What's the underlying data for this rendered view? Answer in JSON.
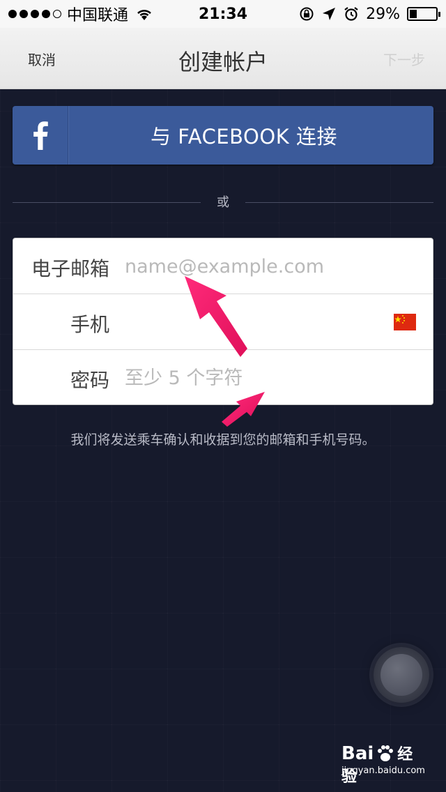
{
  "status_bar": {
    "carrier": "中国联通",
    "time": "21:34",
    "battery_text": "29%",
    "battery_level": 0.29
  },
  "nav": {
    "cancel": "取消",
    "title": "创建帐户",
    "next": "下一步"
  },
  "facebook": {
    "label": "与 FACEBOOK 连接",
    "color": "#3b5a9a"
  },
  "divider": {
    "text": "或"
  },
  "form": {
    "email": {
      "label": "电子邮箱",
      "placeholder": "name@example.com"
    },
    "phone": {
      "label": "手机"
    },
    "password": {
      "label": "密码",
      "placeholder": "至少 5 个字符"
    }
  },
  "hint": "我们将发送乘车确认和收据到您的邮箱和手机号码。",
  "watermark": {
    "brand": "Bai",
    "brand_suffix": "经验",
    "url": "jingyan.baidu.com"
  }
}
